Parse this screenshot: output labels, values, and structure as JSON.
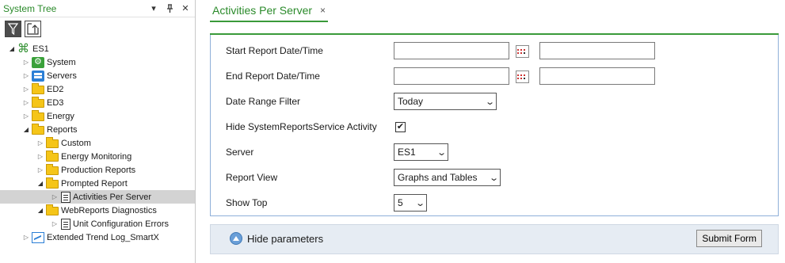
{
  "tree_pane": {
    "title": "System Tree",
    "dropdown_glyph": "▾",
    "pin_glyph": "📌",
    "close_glyph": "✕",
    "tools": [
      {
        "name": "filter-icon",
        "active": true
      },
      {
        "name": "collapse-up-icon",
        "active": false
      }
    ],
    "nodes": [
      {
        "label": "ES1",
        "depth": 0,
        "expander": "open",
        "icon": "network-icon"
      },
      {
        "label": "System",
        "depth": 1,
        "expander": "closed",
        "icon": "system-icon"
      },
      {
        "label": "Servers",
        "depth": 1,
        "expander": "closed",
        "icon": "servers-icon"
      },
      {
        "label": "ED2",
        "depth": 1,
        "expander": "closed",
        "icon": "folder-icon"
      },
      {
        "label": "ED3",
        "depth": 1,
        "expander": "closed",
        "icon": "folder-icon"
      },
      {
        "label": "Energy",
        "depth": 1,
        "expander": "closed",
        "icon": "folder-icon"
      },
      {
        "label": "Reports",
        "depth": 1,
        "expander": "open",
        "icon": "folder-icon"
      },
      {
        "label": "Custom",
        "depth": 2,
        "expander": "closed",
        "icon": "folder-icon"
      },
      {
        "label": "Energy Monitoring",
        "depth": 2,
        "expander": "closed",
        "icon": "folder-icon"
      },
      {
        "label": "Production Reports",
        "depth": 2,
        "expander": "closed",
        "icon": "folder-icon"
      },
      {
        "label": "Prompted Report",
        "depth": 2,
        "expander": "open",
        "icon": "folder-icon"
      },
      {
        "label": "Activities Per Server",
        "depth": 3,
        "expander": "closed",
        "icon": "report-icon",
        "selected": true
      },
      {
        "label": "WebReports Diagnostics",
        "depth": 2,
        "expander": "open",
        "icon": "folder-icon"
      },
      {
        "label": "Unit Configuration Errors",
        "depth": 3,
        "expander": "closed",
        "icon": "report-icon"
      },
      {
        "label": "Extended Trend Log_SmartX",
        "depth": 1,
        "expander": "closed",
        "icon": "trend-log-icon"
      }
    ]
  },
  "tab": {
    "label": "Activities Per Server",
    "close_glyph": "×",
    "accent_color": "#3a9a3a"
  },
  "form": {
    "start_label": "Start Report Date/Time",
    "start_date_value": "",
    "start_time_value": "",
    "end_label": "End Report Date/Time",
    "end_date_value": "",
    "end_time_value": "",
    "date_range_label": "Date Range Filter",
    "date_range_value": "Today",
    "hide_service_label": "Hide SystemReportsService Activity",
    "hide_service_checked": true,
    "check_glyph": "✔",
    "server_label": "Server",
    "server_value": "ES1",
    "report_view_label": "Report View",
    "report_view_value": "Graphs and Tables",
    "show_top_label": "Show Top",
    "show_top_value": "5",
    "chevron_glyph": "⌄"
  },
  "bottom": {
    "hide_params_label": "Hide parameters",
    "submit_label": "Submit Form"
  }
}
